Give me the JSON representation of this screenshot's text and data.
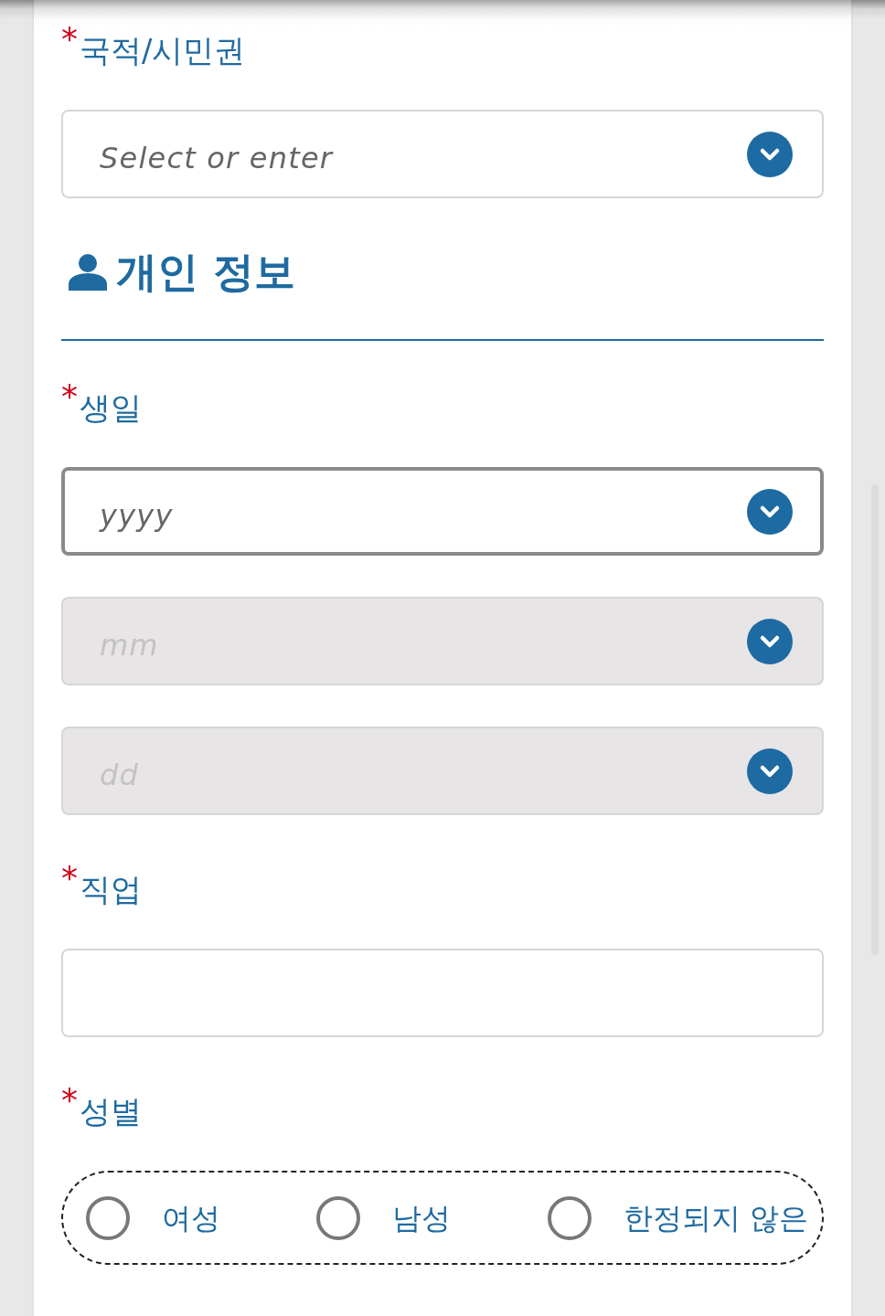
{
  "form": [
    {
      "kind": "field",
      "required_mark": "*",
      "label": "국적/시민권",
      "controls": [
        {
          "kind": "select",
          "placeholder": "Select or enter",
          "focused": false,
          "disabled": false
        }
      ]
    },
    {
      "kind": "section",
      "title": "개인 정보"
    },
    {
      "kind": "field",
      "required_mark": "*",
      "label": "생일",
      "controls": [
        {
          "kind": "select",
          "placeholder": "yyyy",
          "focused": true,
          "disabled": false
        },
        {
          "kind": "select",
          "placeholder": "mm",
          "focused": false,
          "disabled": true
        },
        {
          "kind": "select",
          "placeholder": "dd",
          "focused": false,
          "disabled": true
        }
      ]
    },
    {
      "kind": "field",
      "required_mark": "*",
      "label": "직업",
      "controls": [
        {
          "kind": "text",
          "focused": false,
          "disabled": false
        }
      ]
    },
    {
      "kind": "field",
      "required_mark": "*",
      "label": "성별",
      "controls": [
        {
          "kind": "radio_group",
          "options": [
            {
              "label": "여성",
              "selected": false
            },
            {
              "label": "남성",
              "selected": false
            },
            {
              "label": "한정되지 않은",
              "selected": false
            }
          ]
        }
      ]
    }
  ]
}
